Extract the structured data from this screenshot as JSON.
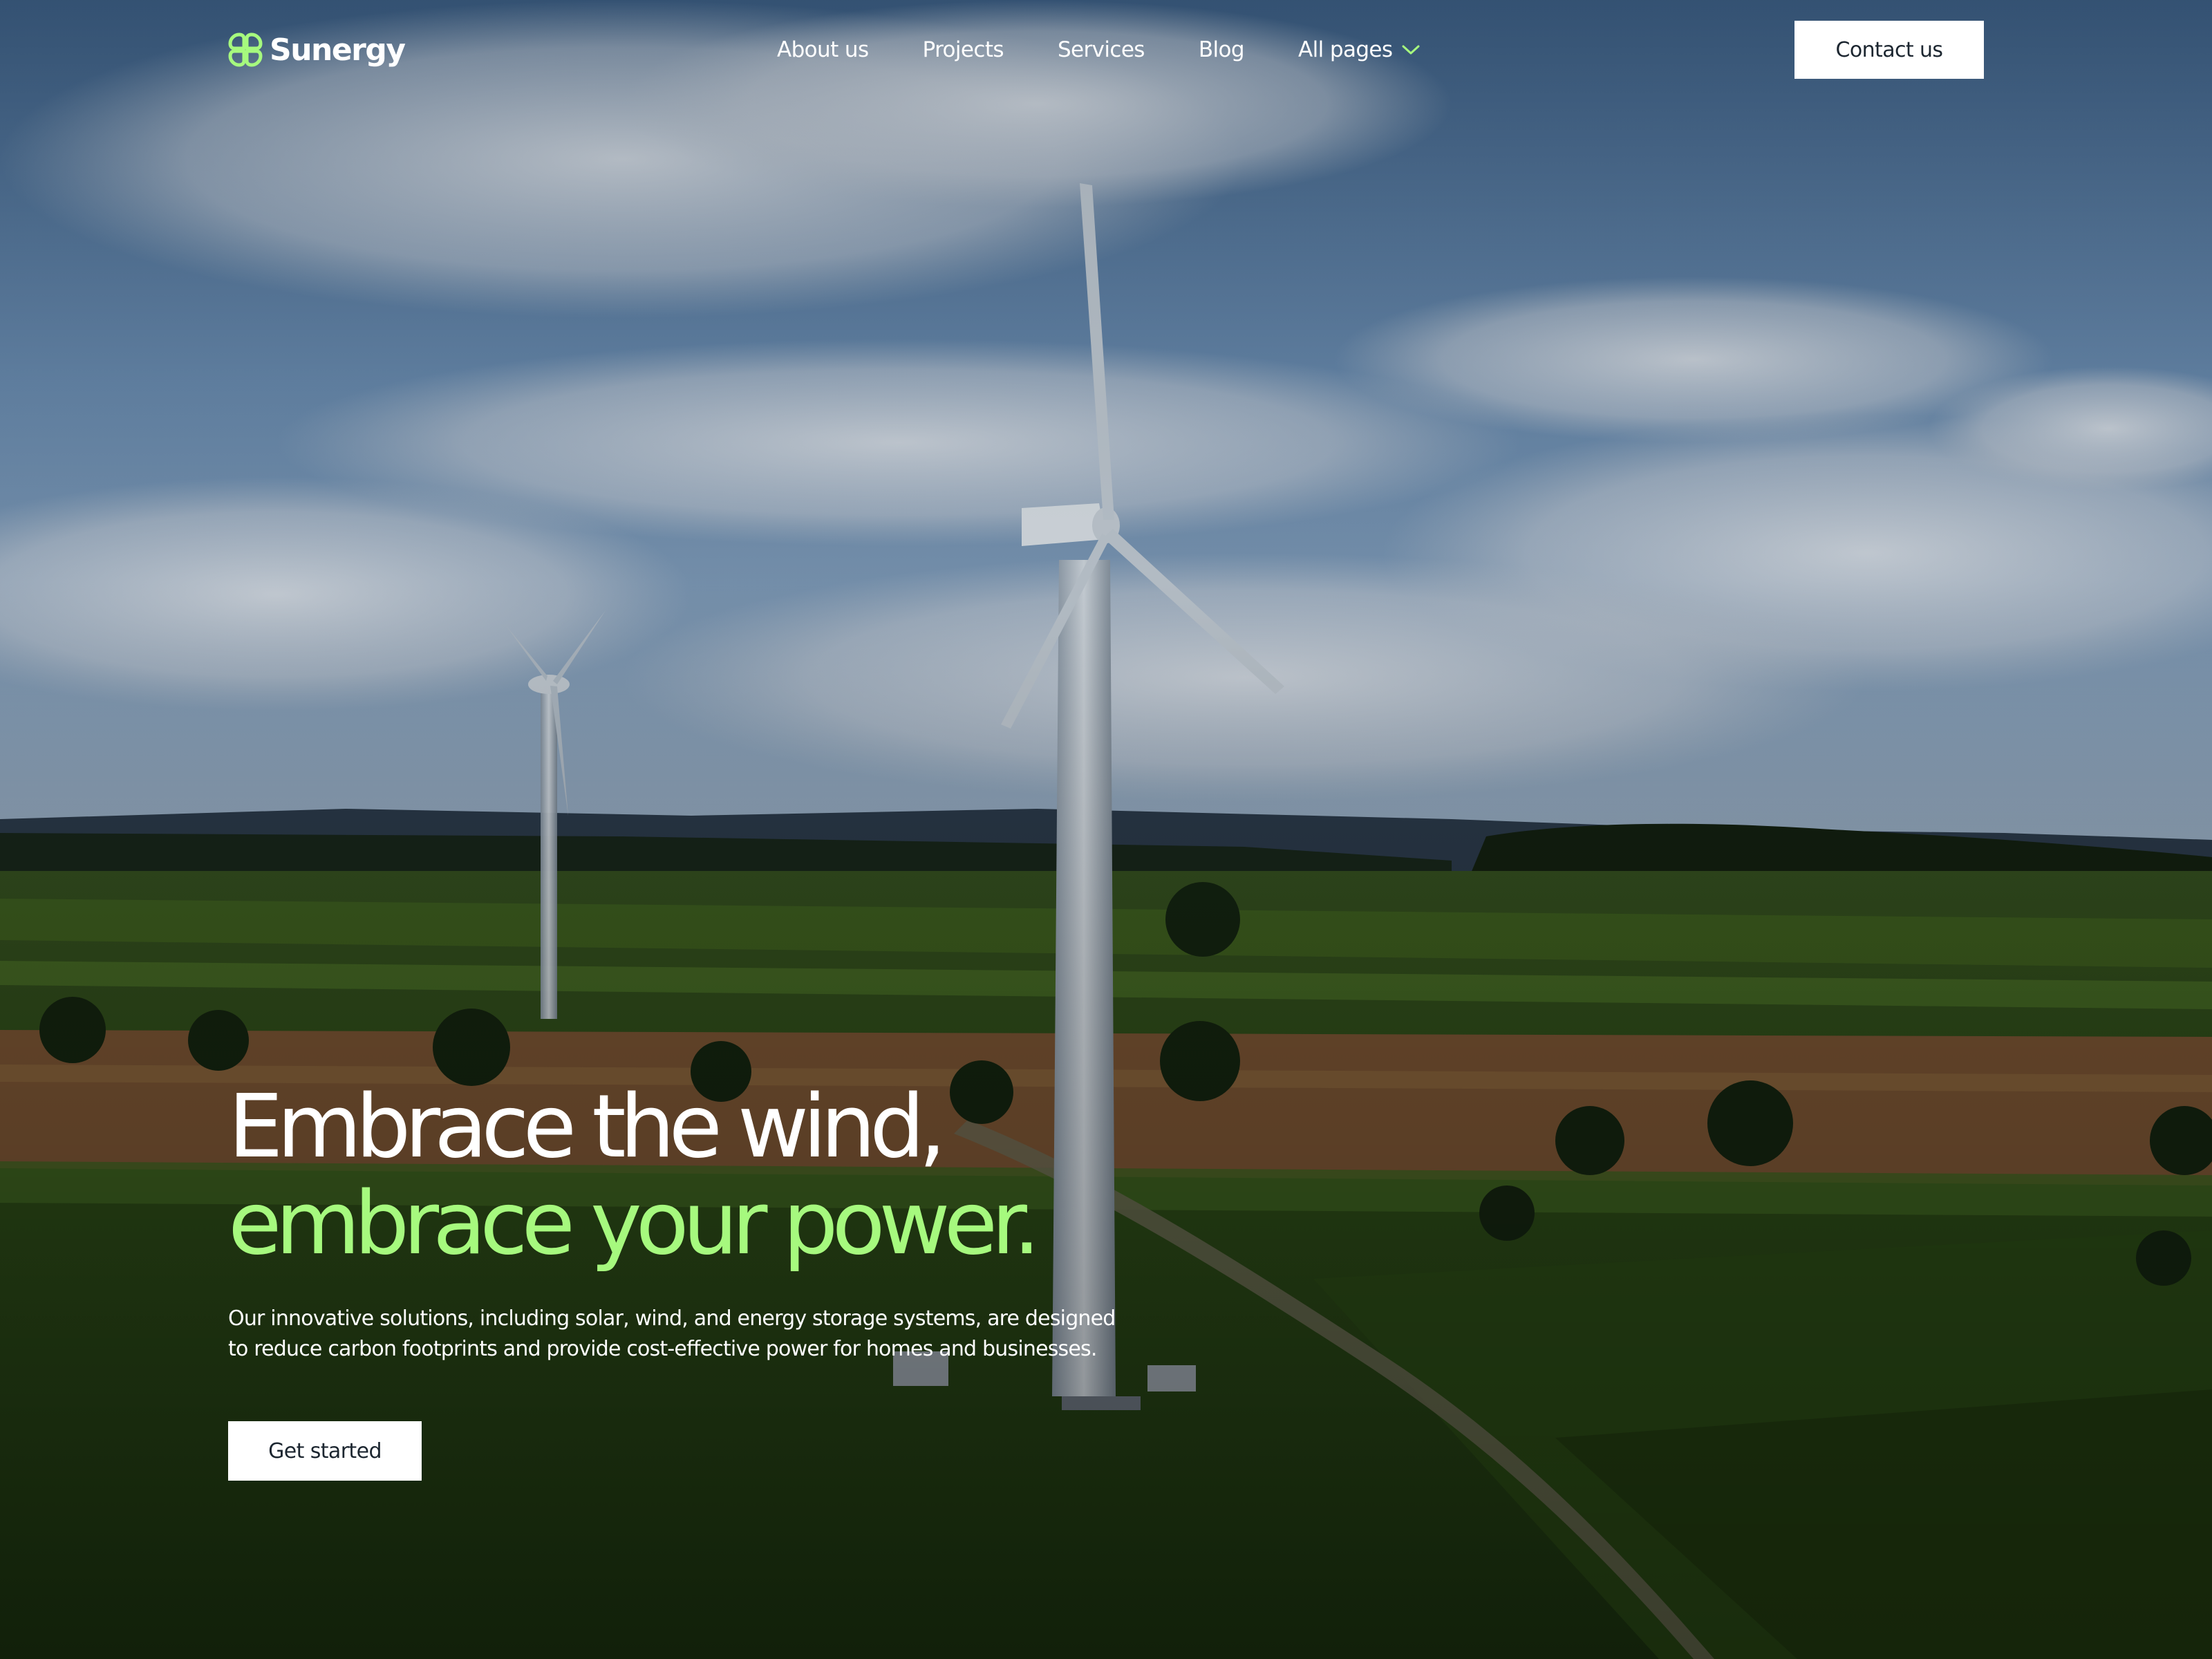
{
  "brand": {
    "name": "Sunergy",
    "accent_color": "#a6f97e",
    "logo_icon": "four-petal-logo-icon"
  },
  "nav": {
    "items": [
      {
        "label": "About us"
      },
      {
        "label": "Projects"
      },
      {
        "label": "Services"
      },
      {
        "label": "Blog"
      },
      {
        "label": "All pages",
        "icon": "chevron-down-icon"
      }
    ],
    "contact_label": "Contact us"
  },
  "hero": {
    "headline_line1": "Embrace the wind,",
    "headline_line2": "embrace your power.",
    "description": "Our innovative solutions, including solar, wind, and energy storage systems, are designed to reduce carbon footprints and provide cost-effective power for homes and businesses.",
    "cta_label": "Get started",
    "background": "wind-turbines-over-farmland-photo"
  }
}
